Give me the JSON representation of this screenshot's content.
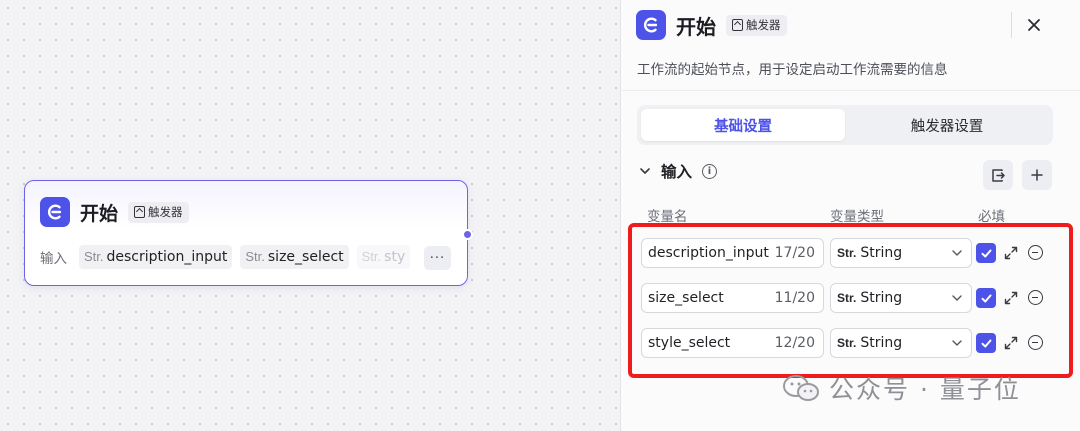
{
  "node": {
    "title": "开始",
    "badge": "触发器",
    "inputs_label": "输入",
    "chips": [
      {
        "type": "Str.",
        "name": "description_input"
      },
      {
        "type": "Str.",
        "name": "size_select"
      },
      {
        "type": "Str.",
        "name": "sty"
      }
    ],
    "more": "···"
  },
  "panel": {
    "title": "开始",
    "badge": "触发器",
    "description": "工作流的起始节点，用于设定启动工作流需要的信息",
    "tabs": [
      {
        "label": "基础设置",
        "active": true
      },
      {
        "label": "触发器设置",
        "active": false
      }
    ],
    "section_title": "输入",
    "columns": {
      "name": "变量名",
      "type": "变量类型",
      "required": "必填"
    },
    "rows": [
      {
        "name": "description_input",
        "count": "17/20",
        "type_prefix": "Str.",
        "type": "String",
        "required": true
      },
      {
        "name": "size_select",
        "count": "11/20",
        "type_prefix": "Str.",
        "type": "String",
        "required": true
      },
      {
        "name": "style_select",
        "count": "12/20",
        "type_prefix": "Str.",
        "type": "String",
        "required": true
      }
    ]
  },
  "watermark": "公众号 · 量子位",
  "colors": {
    "accent": "#4d53e8",
    "highlight": "#ee1c1c",
    "node_border": "#6e63e8"
  }
}
